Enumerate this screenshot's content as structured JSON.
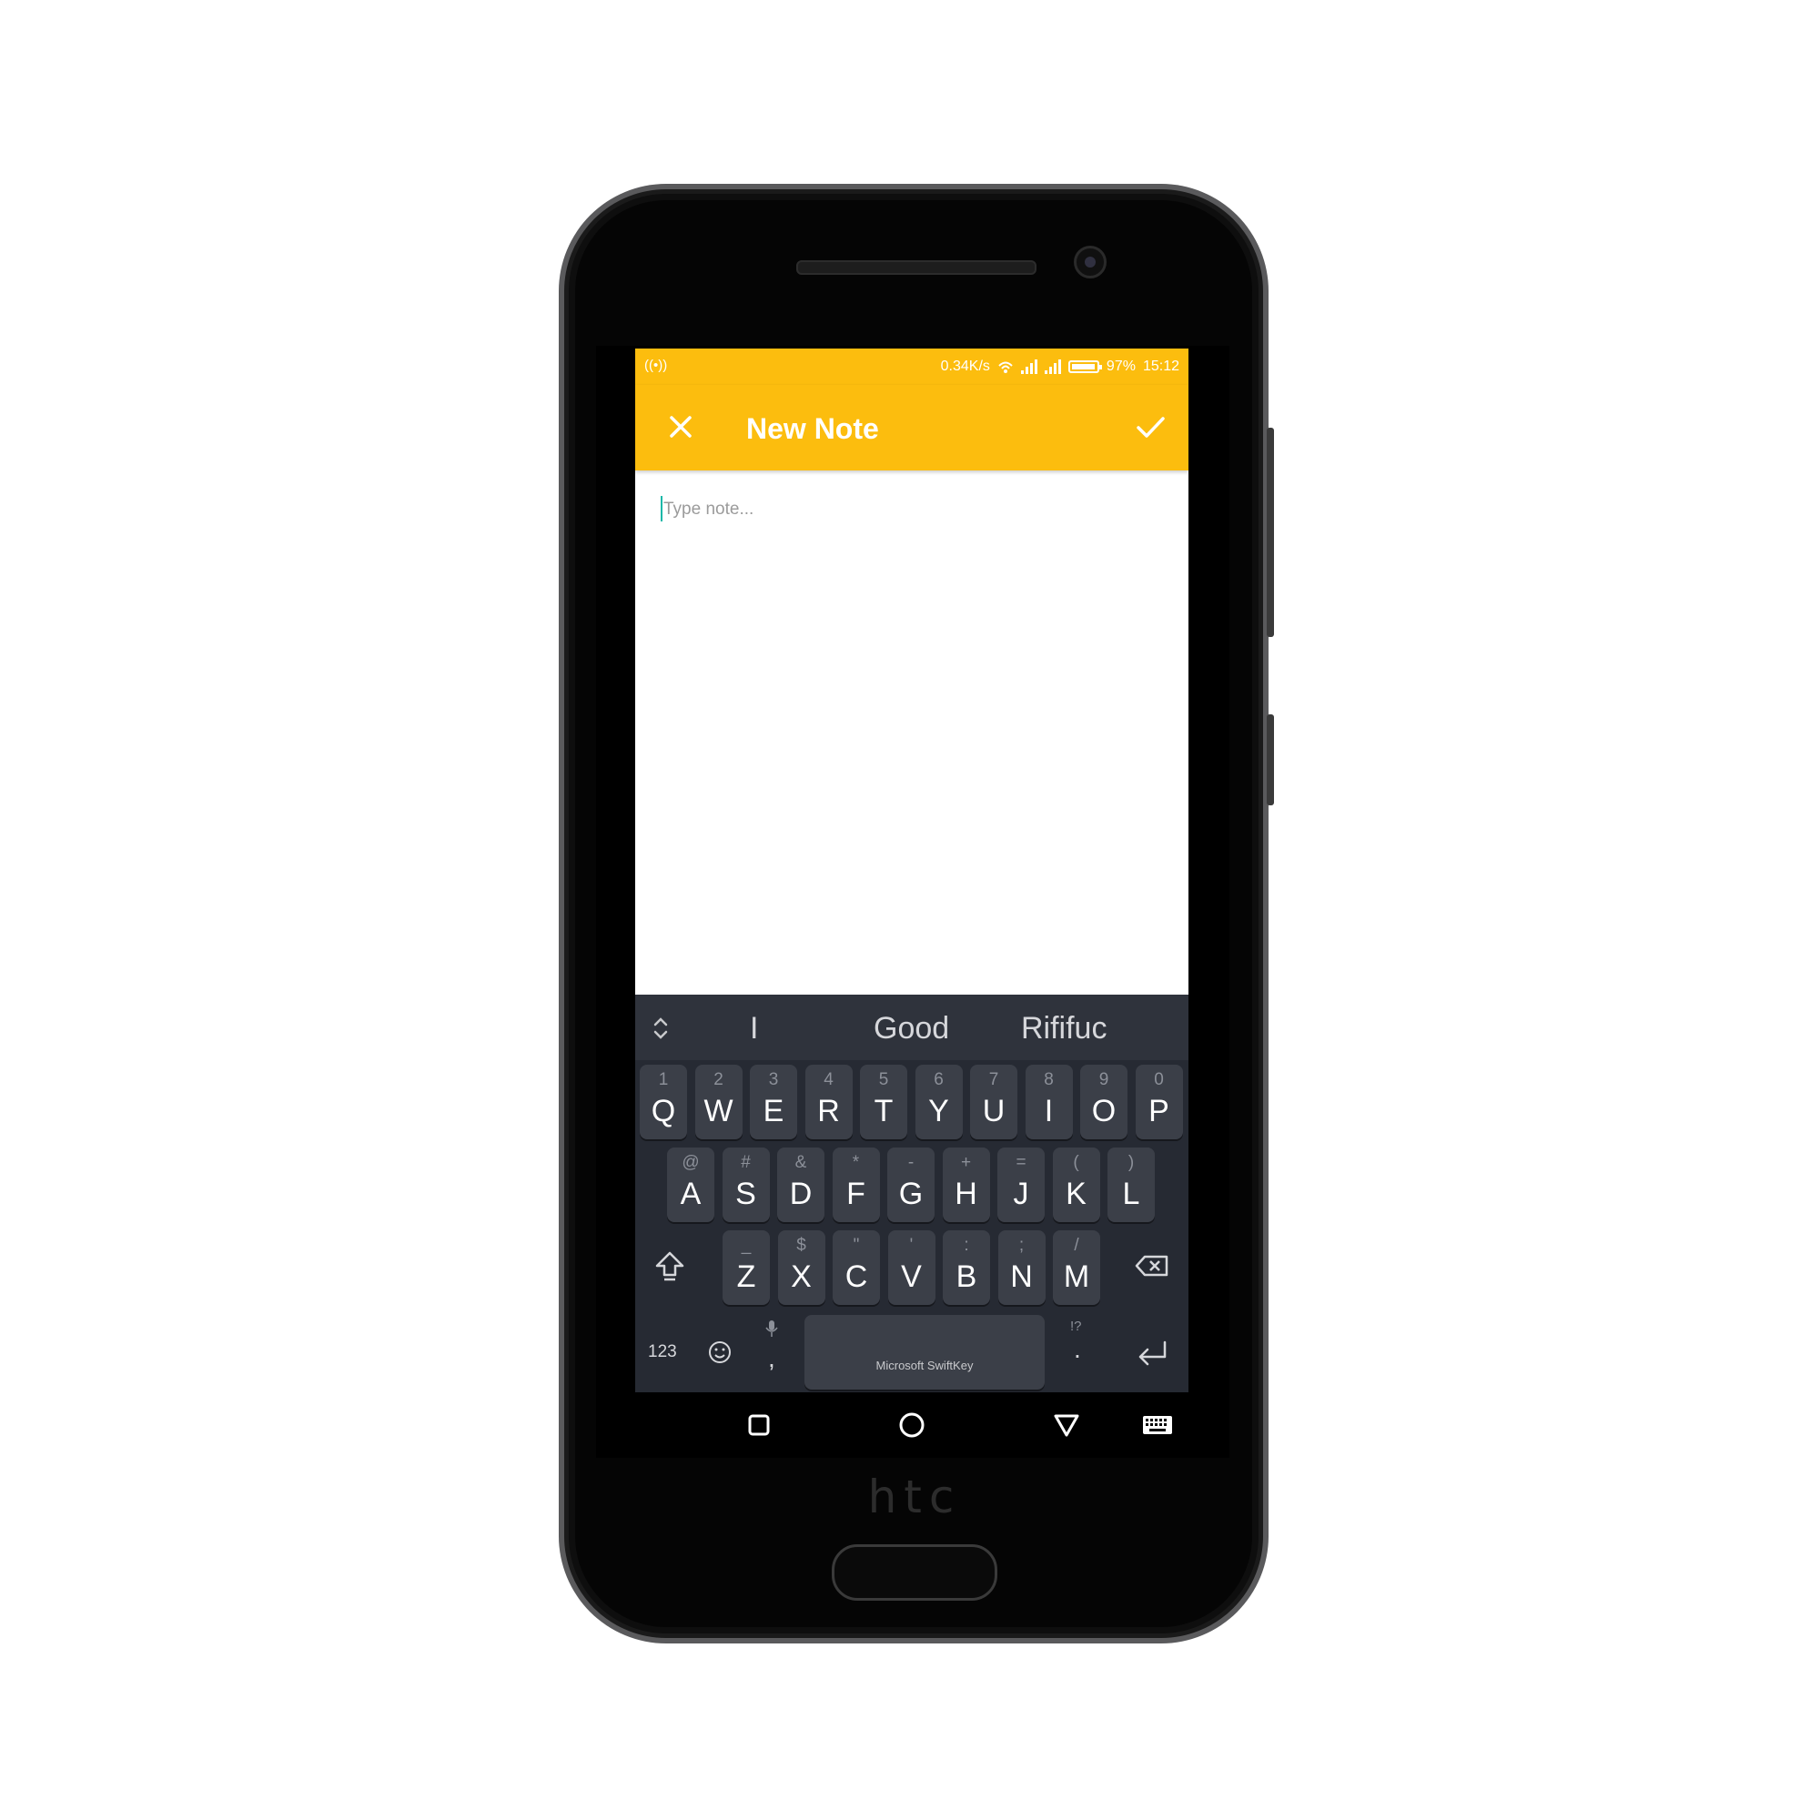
{
  "device": {
    "brand": "htc"
  },
  "status_bar": {
    "net_speed": "0.34K/s",
    "battery_pct": "97%",
    "time": "15:12",
    "battery_level": 0.97
  },
  "toolbar": {
    "title": "New Note",
    "close_icon": "close-icon",
    "save_icon": "checkmark-icon"
  },
  "editor": {
    "placeholder": "Type note...",
    "value": ""
  },
  "colors": {
    "accent": "#FCBD0E",
    "keyboard_bg": "#262a33",
    "key_bg": "#3b3f48",
    "caret": "#18b8a8"
  },
  "keyboard": {
    "suggestions": [
      "I",
      "Good",
      "Rififuc"
    ],
    "row1": [
      {
        "hint": "1",
        "main": "Q"
      },
      {
        "hint": "2",
        "main": "W"
      },
      {
        "hint": "3",
        "main": "E"
      },
      {
        "hint": "4",
        "main": "R"
      },
      {
        "hint": "5",
        "main": "T"
      },
      {
        "hint": "6",
        "main": "Y"
      },
      {
        "hint": "7",
        "main": "U"
      },
      {
        "hint": "8",
        "main": "I"
      },
      {
        "hint": "9",
        "main": "O"
      },
      {
        "hint": "0",
        "main": "P"
      }
    ],
    "row2": [
      {
        "hint": "@",
        "main": "A"
      },
      {
        "hint": "#",
        "main": "S"
      },
      {
        "hint": "&",
        "main": "D"
      },
      {
        "hint": "*",
        "main": "F"
      },
      {
        "hint": "-",
        "main": "G"
      },
      {
        "hint": "+",
        "main": "H"
      },
      {
        "hint": "=",
        "main": "J"
      },
      {
        "hint": "(",
        "main": "K"
      },
      {
        "hint": ")",
        "main": "L"
      }
    ],
    "row3": [
      {
        "hint": "_",
        "main": "Z"
      },
      {
        "hint": "$",
        "main": "X"
      },
      {
        "hint": "\"",
        "main": "C"
      },
      {
        "hint": "'",
        "main": "V"
      },
      {
        "hint": ":",
        "main": "B"
      },
      {
        "hint": ";",
        "main": "N"
      },
      {
        "hint": "/",
        "main": "M"
      }
    ],
    "numbers_label": "123",
    "comma": ",",
    "period": ".",
    "period_hint": "!?",
    "space_label": "Microsoft SwiftKey"
  },
  "nav": {
    "icons": [
      "recents-icon",
      "home-icon",
      "back-icon",
      "keyboard-icon"
    ]
  }
}
